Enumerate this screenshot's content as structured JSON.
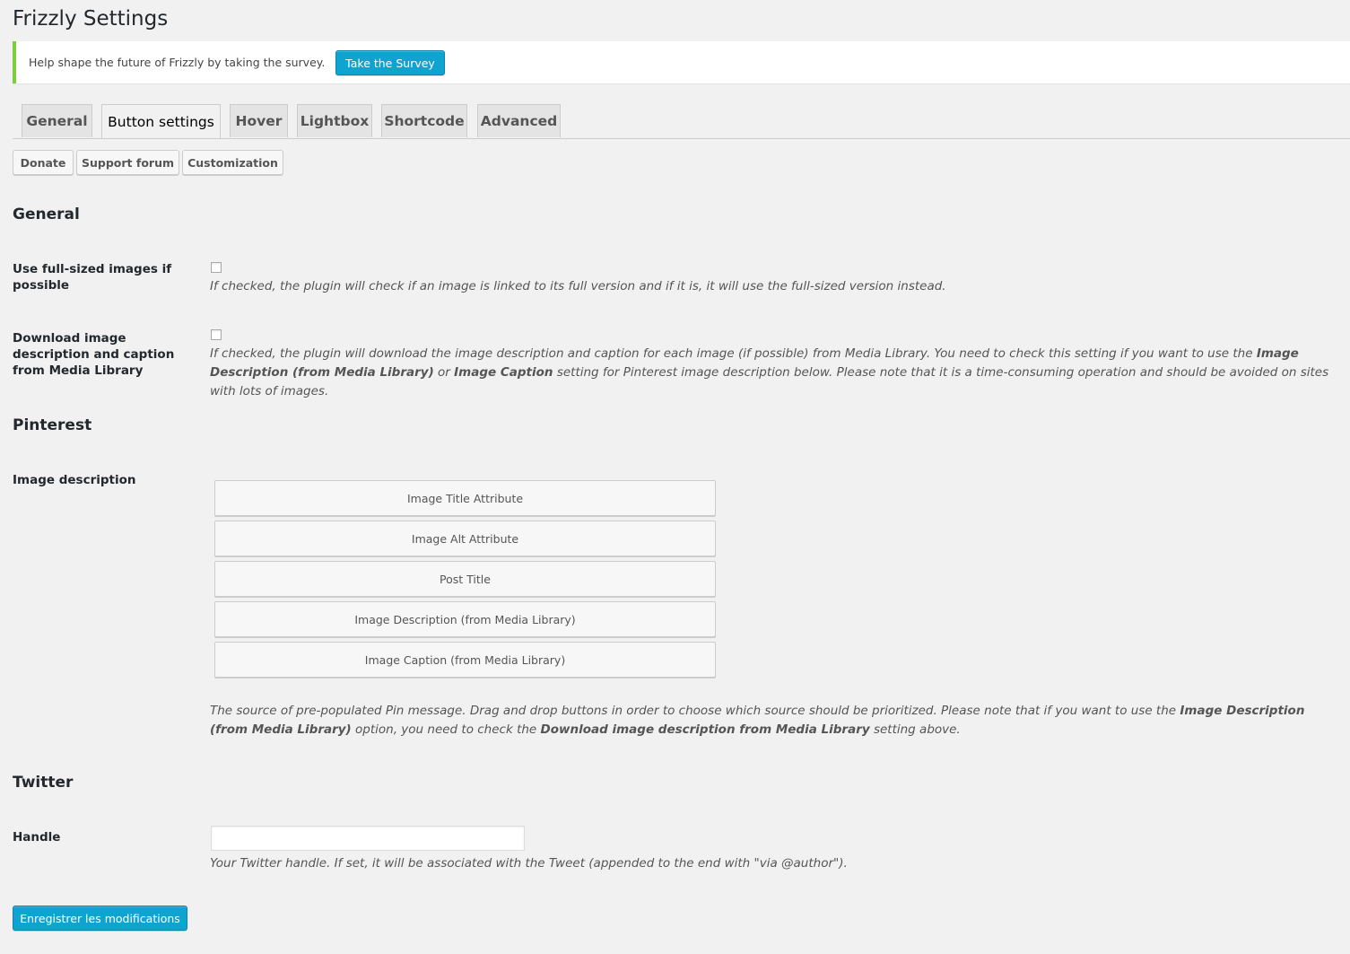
{
  "page": {
    "title": "Frizzly Settings"
  },
  "notice": {
    "text": "Help shape the future of Frizzly by taking the survey.",
    "button": "Take the Survey"
  },
  "tabs": [
    {
      "label": "General"
    },
    {
      "label": "Button settings",
      "active": true
    },
    {
      "label": "Hover"
    },
    {
      "label": "Lightbox"
    },
    {
      "label": "Shortcode"
    },
    {
      "label": "Advanced"
    }
  ],
  "subnav": [
    {
      "label": "Donate"
    },
    {
      "label": "Support forum"
    },
    {
      "label": "Customization"
    }
  ],
  "general": {
    "heading": "General",
    "full_size": {
      "label": "Use full-sized images if possible",
      "checked": false,
      "description": "If checked, the plugin will check if an image is linked to its full version and if it is, it will use the full-sized version instead."
    },
    "download_desc": {
      "label": "Download image description and caption from Media Library",
      "checked": false,
      "desc_part1": "If checked, the plugin will download the image description and caption for each image (if possible) from Media Library. You need to check this setting if you want to use the ",
      "desc_bold1": "Image Description (from Media Library)",
      "desc_part2": " or ",
      "desc_bold2": "Image Caption",
      "desc_part3": " setting for Pinterest image description below. Please note that it is a time-consuming operation and should be avoided on sites with lots of images."
    }
  },
  "pinterest": {
    "heading": "Pinterest",
    "image_description": {
      "label": "Image description",
      "sources": [
        "Image Title Attribute",
        "Image Alt Attribute",
        "Post Title",
        "Image Description (from Media Library)",
        "Image Caption (from Media Library)"
      ],
      "desc_part1": "The source of pre-populated Pin message. Drag and drop buttons in order to choose which source should be prioritized. Please note that if you want to use the ",
      "desc_bold1": "Image Description (from Media Library)",
      "desc_part2": " option, you need to check the ",
      "desc_bold2": "Download image description from Media Library",
      "desc_part3": " setting above."
    }
  },
  "twitter": {
    "heading": "Twitter",
    "handle": {
      "label": "Handle",
      "value": "",
      "description": "Your Twitter handle. If set, it will be associated with the Tweet (appended to the end with \"via @author\")."
    }
  },
  "save_button": "Enregistrer les modifications",
  "colors": {
    "primary": "#0ea4cf",
    "notice_border": "#7ad03a",
    "background": "#f1f1f1"
  }
}
